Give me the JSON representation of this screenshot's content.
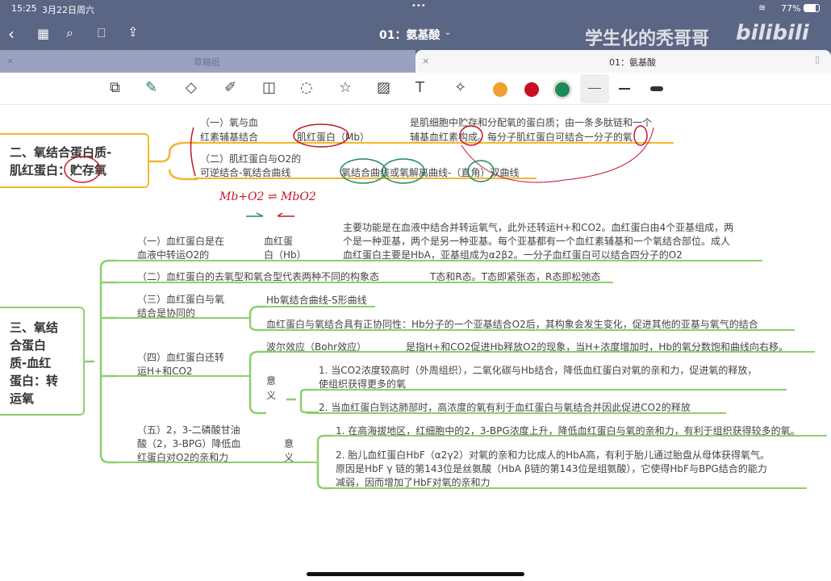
{
  "status_bar": {
    "time": "15:25",
    "date": "3月22日周六",
    "battery": "77%"
  },
  "nav": {
    "title": "01：氨基酸",
    "watermark": "学生化的秃哥哥",
    "logo": "bilibili"
  },
  "tabs": [
    {
      "label": "草稿纸"
    },
    {
      "label": "01：氨基酸"
    }
  ],
  "toolbar": {
    "colors": [
      "#f0a030",
      "#c8101e",
      "#1e8a5a"
    ]
  },
  "section2": {
    "title_line1": "二、氧结合蛋白质-",
    "title_line2": "肌红蛋白：贮存氧",
    "b1": {
      "label1": "（一）氧与血",
      "label2": "红素辅基结合",
      "term": "肌红蛋白（Mb）",
      "desc1": "是肌细胞中贮存和分配氧的蛋白质；由一条多肽链和一个",
      "desc2": "辅基血红素构成。每分子肌红蛋白可结合一分子的氧"
    },
    "b2": {
      "label1": "（二）肌红蛋白与O2的",
      "label2": "可逆结合-氧结合曲线",
      "desc": "氧结合曲线或氧解离曲线-（直角）双曲线"
    },
    "handwriting": "Mb+O2 ⇌ MbO2"
  },
  "section3": {
    "title_lines": [
      "三、氧结",
      "合蛋白",
      "质-血红",
      "蛋白：转",
      "运氧"
    ],
    "b1": {
      "label1": "（一）血红蛋白是在",
      "label2": "血液中转运O2的",
      "term1": "血红蛋",
      "term2": "白（Hb）",
      "desc": [
        "主要功能是在血液中结合并转运氧气，此外还转运H+和CO2。血红蛋白由4个亚基组成，两",
        "个是一种亚基，两个是另一种亚基。每个亚基都有一个血红素辅基和一个氧结合部位。成人",
        "血红蛋白主要是HbA，亚基组成为α2β2。一分子血红蛋白可以结合四分子的O2"
      ]
    },
    "b2": {
      "label": "（二）血红蛋白的去氧型和氧合型代表两种不同的构象态",
      "desc": "T态和R态。T态即紧张态，R态即松弛态"
    },
    "b3": {
      "label1": "（三）血红蛋白与氧",
      "label2": "结合是协同的",
      "sub1": "Hb氧结合曲线-S形曲线",
      "sub2": "血红蛋白与氧结合具有正协同性：Hb分子的一个亚基结合O2后，其构象会发生变化，促进其他的亚基与氧气的结合"
    },
    "b4": {
      "label1": "（四）血红蛋白还转",
      "label2": "运H+和CO2",
      "bohr": "波尔效应（Bohr效应）",
      "bohr_desc": "是指H+和CO2促进Hb释放O2的现象，当H+浓度增加时，Hb的氧分数饱和曲线向右移。",
      "meaning1": "意",
      "meaning2": "义",
      "m1a": "1. 当CO2浓度较高时（外周组织），二氧化碳与Hb结合，降低血红蛋白对氧的亲和力，促进氧的释放，",
      "m1b": "使组织获得更多的氧",
      "m2": "2. 当血红蛋白到达肺部时，高浓度的氧有利于血红蛋白与氧结合并因此促进CO2的释放"
    },
    "b5": {
      "label1": "（五）2，3-二磷酸甘油",
      "label2": "酸（2，3-BPG）降低血",
      "label3": "红蛋白对O2的亲和力",
      "meaning1": "意",
      "meaning2": "义",
      "m1": "1. 在高海拔地区，红细胞中的2，3-BPG浓度上升，降低血红蛋白与氧的亲和力，有利于组织获得较多的氧。",
      "m2a": "2. 胎儿血红蛋白HbF（α2γ2）对氧的亲和力比成人的HbA高，有利于胎儿通过胎盘从母体获得氧气。",
      "m2b": "原因是HbF γ 链的第143位是丝氨酸（HbA β链的第143位是组氨酸），它使得HbF与BPG结合的能力",
      "m2c": "减弱，因而增加了HbF对氧的亲和力"
    }
  }
}
